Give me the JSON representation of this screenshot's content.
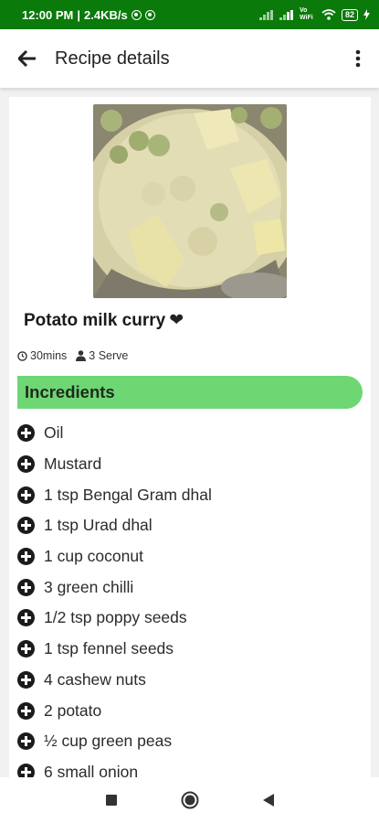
{
  "status_bar": {
    "time": "12:00 PM",
    "speed": "2.4KB/s",
    "network_label": "Vo WiFi",
    "battery": "82"
  },
  "app_bar": {
    "title": "Recipe details"
  },
  "recipe": {
    "title": "Potato milk curry",
    "heart": "❤",
    "time": "30mins",
    "serves": "3 Serve"
  },
  "section": {
    "title": "Incredients"
  },
  "ingredients": [
    "Oil",
    "Mustard",
    "1 tsp Bengal Gram dhal",
    "1 tsp Urad dhal",
    "1 cup coconut",
    "3 green chilli",
    "1/2 tsp poppy seeds",
    "1 tsp fennel seeds",
    "4 cashew nuts",
    "2 potato",
    "½ cup green peas",
    "6 small onion"
  ],
  "colors": {
    "status_bar": "#0a7a0a",
    "section_header": "#6fd674"
  },
  "icons": {
    "back": "arrow-left-icon",
    "more": "more-vert-icon",
    "clock": "clock-icon",
    "person": "person-icon",
    "add": "plus-circle-icon"
  }
}
